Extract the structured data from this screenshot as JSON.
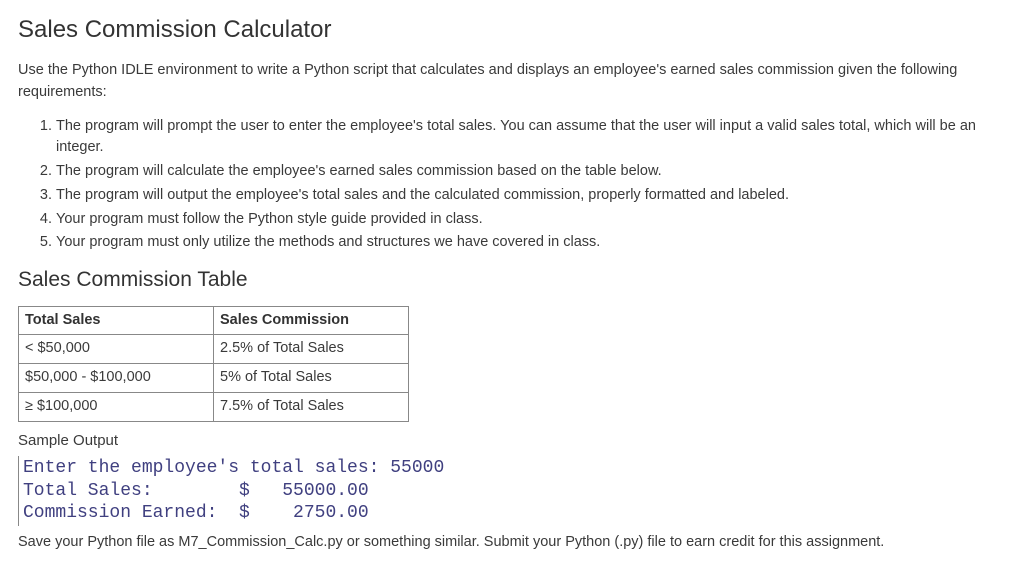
{
  "title": "Sales Commission Calculator",
  "intro": "Use the Python IDLE environment to write a Python script that calculates and displays an employee's earned sales commission given the following requirements:",
  "requirements": [
    "The program will prompt the user to enter the employee's total sales. You can assume that the user will input a valid sales total, which will be an integer.",
    "The program will calculate the employee's earned sales commission based on the table below.",
    "The program will output the employee's total sales and the calculated commission, properly formatted and labeled.",
    "Your program must follow the Python style guide provided in class.",
    "Your program must only utilize the methods and structures we have covered in class."
  ],
  "table_heading": "Sales Commission Table",
  "table": {
    "headers": [
      "Total Sales",
      "Sales Commission"
    ],
    "rows": [
      [
        "< $50,000",
        "2.5% of Total Sales"
      ],
      [
        "$50,000 - $100,000",
        "5% of Total Sales"
      ],
      [
        "≥ $100,000",
        "7.5% of Total Sales"
      ]
    ]
  },
  "sample_label": "Sample Output",
  "sample_output": "Enter the employee's total sales: 55000\nTotal Sales:        $   55000.00\nCommission Earned:  $    2750.00",
  "footer": "Save your Python file as M7_Commission_Calc.py or something similar. Submit your Python (.py) file to earn credit for this assignment."
}
